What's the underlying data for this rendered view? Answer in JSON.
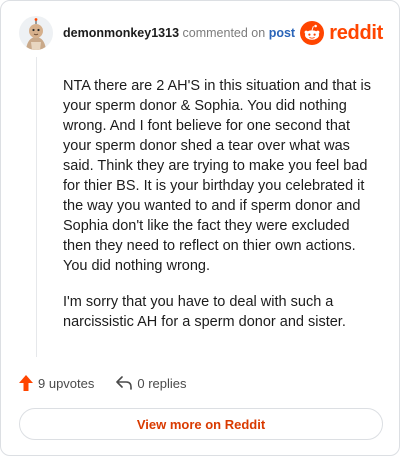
{
  "header": {
    "username": "demonmonkey1313",
    "action_text": "commented on",
    "post_link": "post",
    "brand_name": "reddit"
  },
  "comment": {
    "paragraphs": [
      "NTA there are 2 AH'S in this situation and that is your sperm donor & Sophia. You did nothing wrong. And I font believe for one second that your sperm donor shed a tear over what was said. Think they are trying to make you feel bad for thier BS. It is your birthday you celebrated it the way you wanted to and if sperm donor and Sophia don't like the fact they were excluded then they need to reflect on thier own actions. You did nothing wrong.",
      "I'm sorry that you have to deal with such a narcissistic AH for a sperm donor and sister."
    ]
  },
  "actions": {
    "upvotes": "9 upvotes",
    "replies": "0 replies"
  },
  "cta": {
    "view_label": "View more on Reddit"
  },
  "colors": {
    "brand": "#ff4500",
    "link": "#2a64b8",
    "cta_text": "#d93a00"
  },
  "icons": [
    "avatar",
    "reddit-logo-icon",
    "upvote-arrow-icon",
    "reply-arrow-icon"
  ]
}
